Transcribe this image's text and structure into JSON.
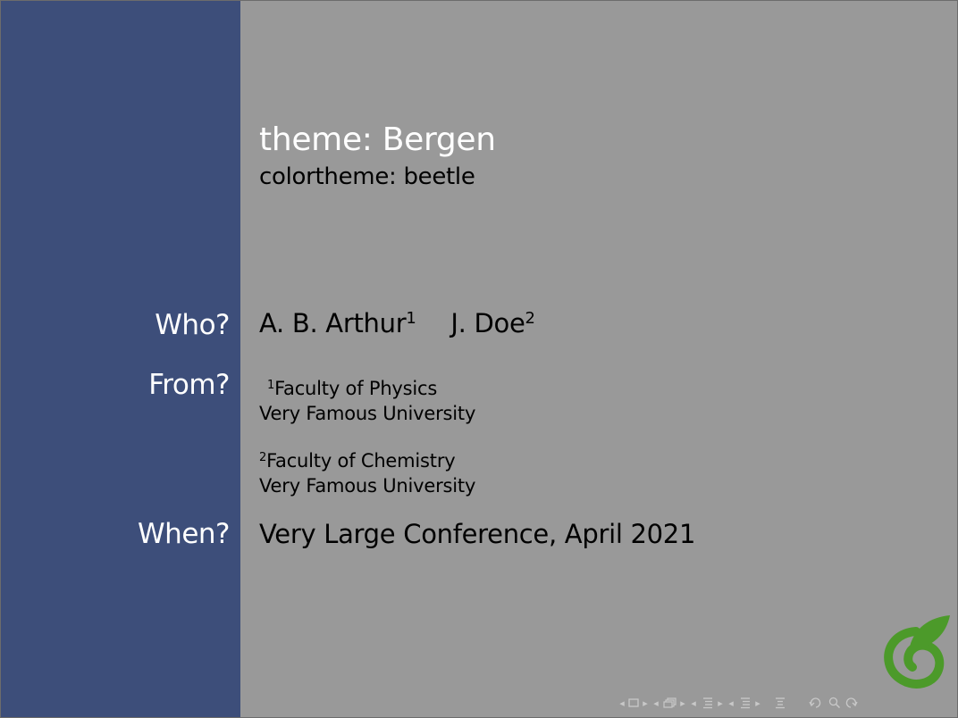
{
  "slide": {
    "title": "theme: Bergen",
    "subtitle": "colortheme: beetle",
    "labels": {
      "who": "Who?",
      "from": "From?",
      "when": "When?"
    },
    "authors": [
      {
        "name": "A. B. Arthur",
        "mark": "1"
      },
      {
        "name": "J. Doe",
        "mark": "2"
      }
    ],
    "institutes": [
      {
        "mark": "1",
        "line1": "Faculty of Physics",
        "line2": "Very Famous University"
      },
      {
        "mark": "2",
        "line1": "Faculty of Chemistry",
        "line2": "Very Famous University"
      }
    ],
    "date": "Very Large Conference, April 2021"
  },
  "colors": {
    "sidebar": "#3d4e7a",
    "background": "#999999",
    "title": "#ffffff",
    "text": "#000000",
    "logo": "#4c9a2a",
    "nav_symbols": "#c8c8c8"
  },
  "logo": {
    "icon": "overleaf-leaf-icon"
  },
  "navigation": {
    "icons": [
      "nav-prev-frame-icon",
      "nav-frame-icon",
      "nav-next-frame-icon",
      "nav-prev-subsection-icon",
      "nav-subsection-icon",
      "nav-next-subsection-icon",
      "nav-prev-section-icon",
      "nav-section-icon",
      "nav-next-section-icon",
      "nav-prev-page-icon",
      "nav-page-icon",
      "nav-next-page-icon",
      "nav-align-icon",
      "nav-back-icon",
      "nav-search-icon",
      "nav-forward-icon"
    ]
  }
}
